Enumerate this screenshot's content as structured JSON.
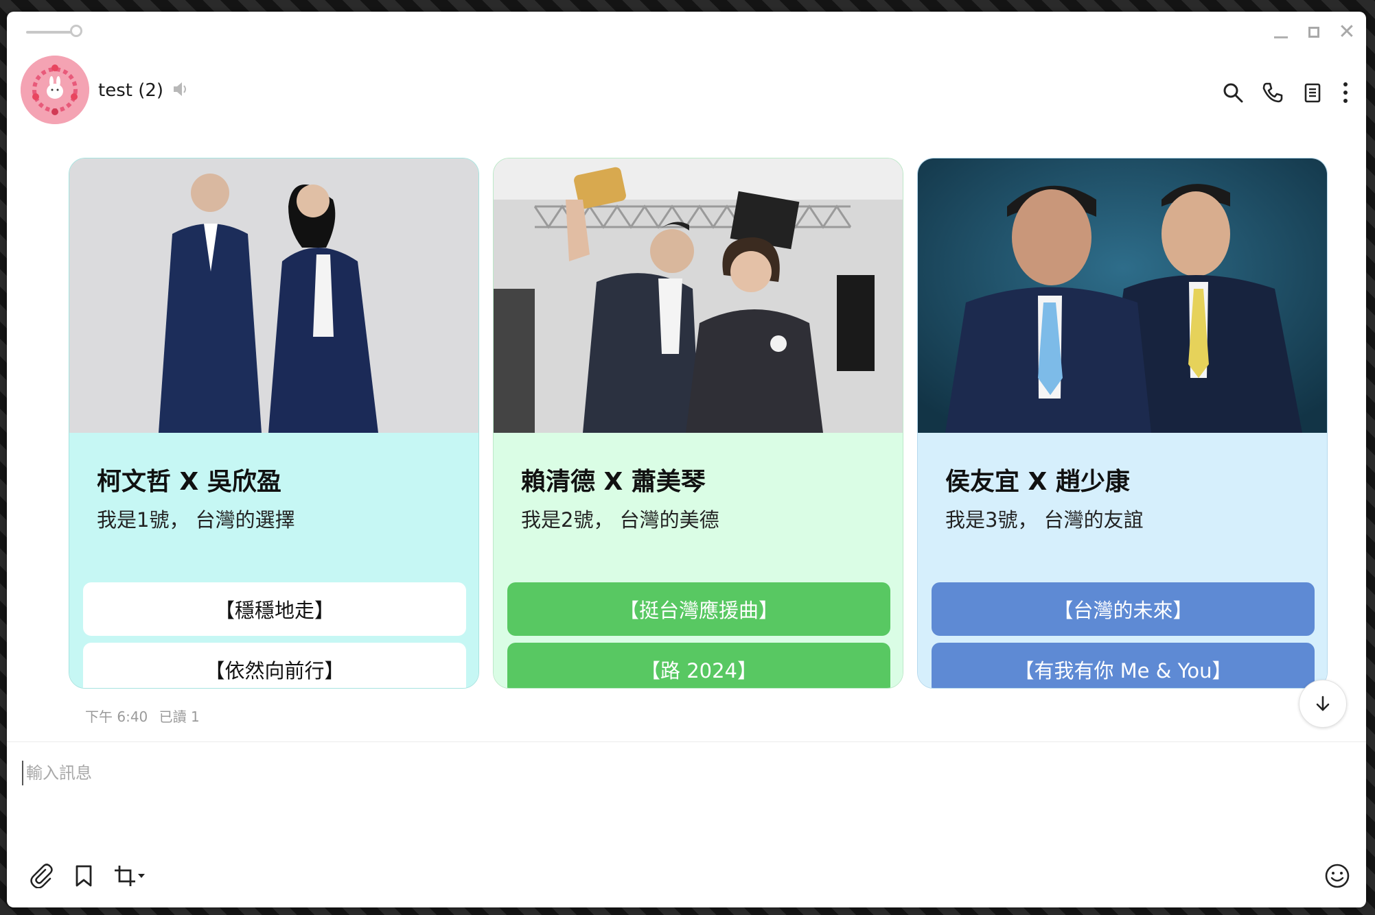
{
  "header": {
    "chat_title": "test (2)"
  },
  "cards": [
    {
      "title": "柯文哲 X 吳欣盈",
      "subtitle": "我是1號， 台灣的選擇",
      "buttons": [
        "【穩穩地走】",
        "【依然向前行】"
      ],
      "body_color": "#c6f7f4",
      "border_color": "#a6e3df",
      "button_bg": "#ffffff",
      "button_fg": "#111111"
    },
    {
      "title": "賴清德 X 蕭美琴",
      "subtitle": "我是2號， 台灣的美德",
      "buttons": [
        "【挺台灣應援曲】",
        "【路 2024】"
      ],
      "body_color": "#dafde5",
      "border_color": "#bce9c8",
      "button_bg": "#58c862",
      "button_fg": "#ffffff"
    },
    {
      "title": "侯友宜 X 趙少康",
      "subtitle": "我是3號， 台灣的友誼",
      "buttons": [
        "【台灣的未來】",
        "【有我有你 Me & You】"
      ],
      "body_color": "#d6effc",
      "border_color": "#b5d9ee",
      "button_bg": "#5e8ad4",
      "button_fg": "#ffffff"
    }
  ],
  "message_meta": {
    "time": "下午 6:40",
    "read": "已讀 1"
  },
  "composer": {
    "placeholder": "輸入訊息"
  }
}
